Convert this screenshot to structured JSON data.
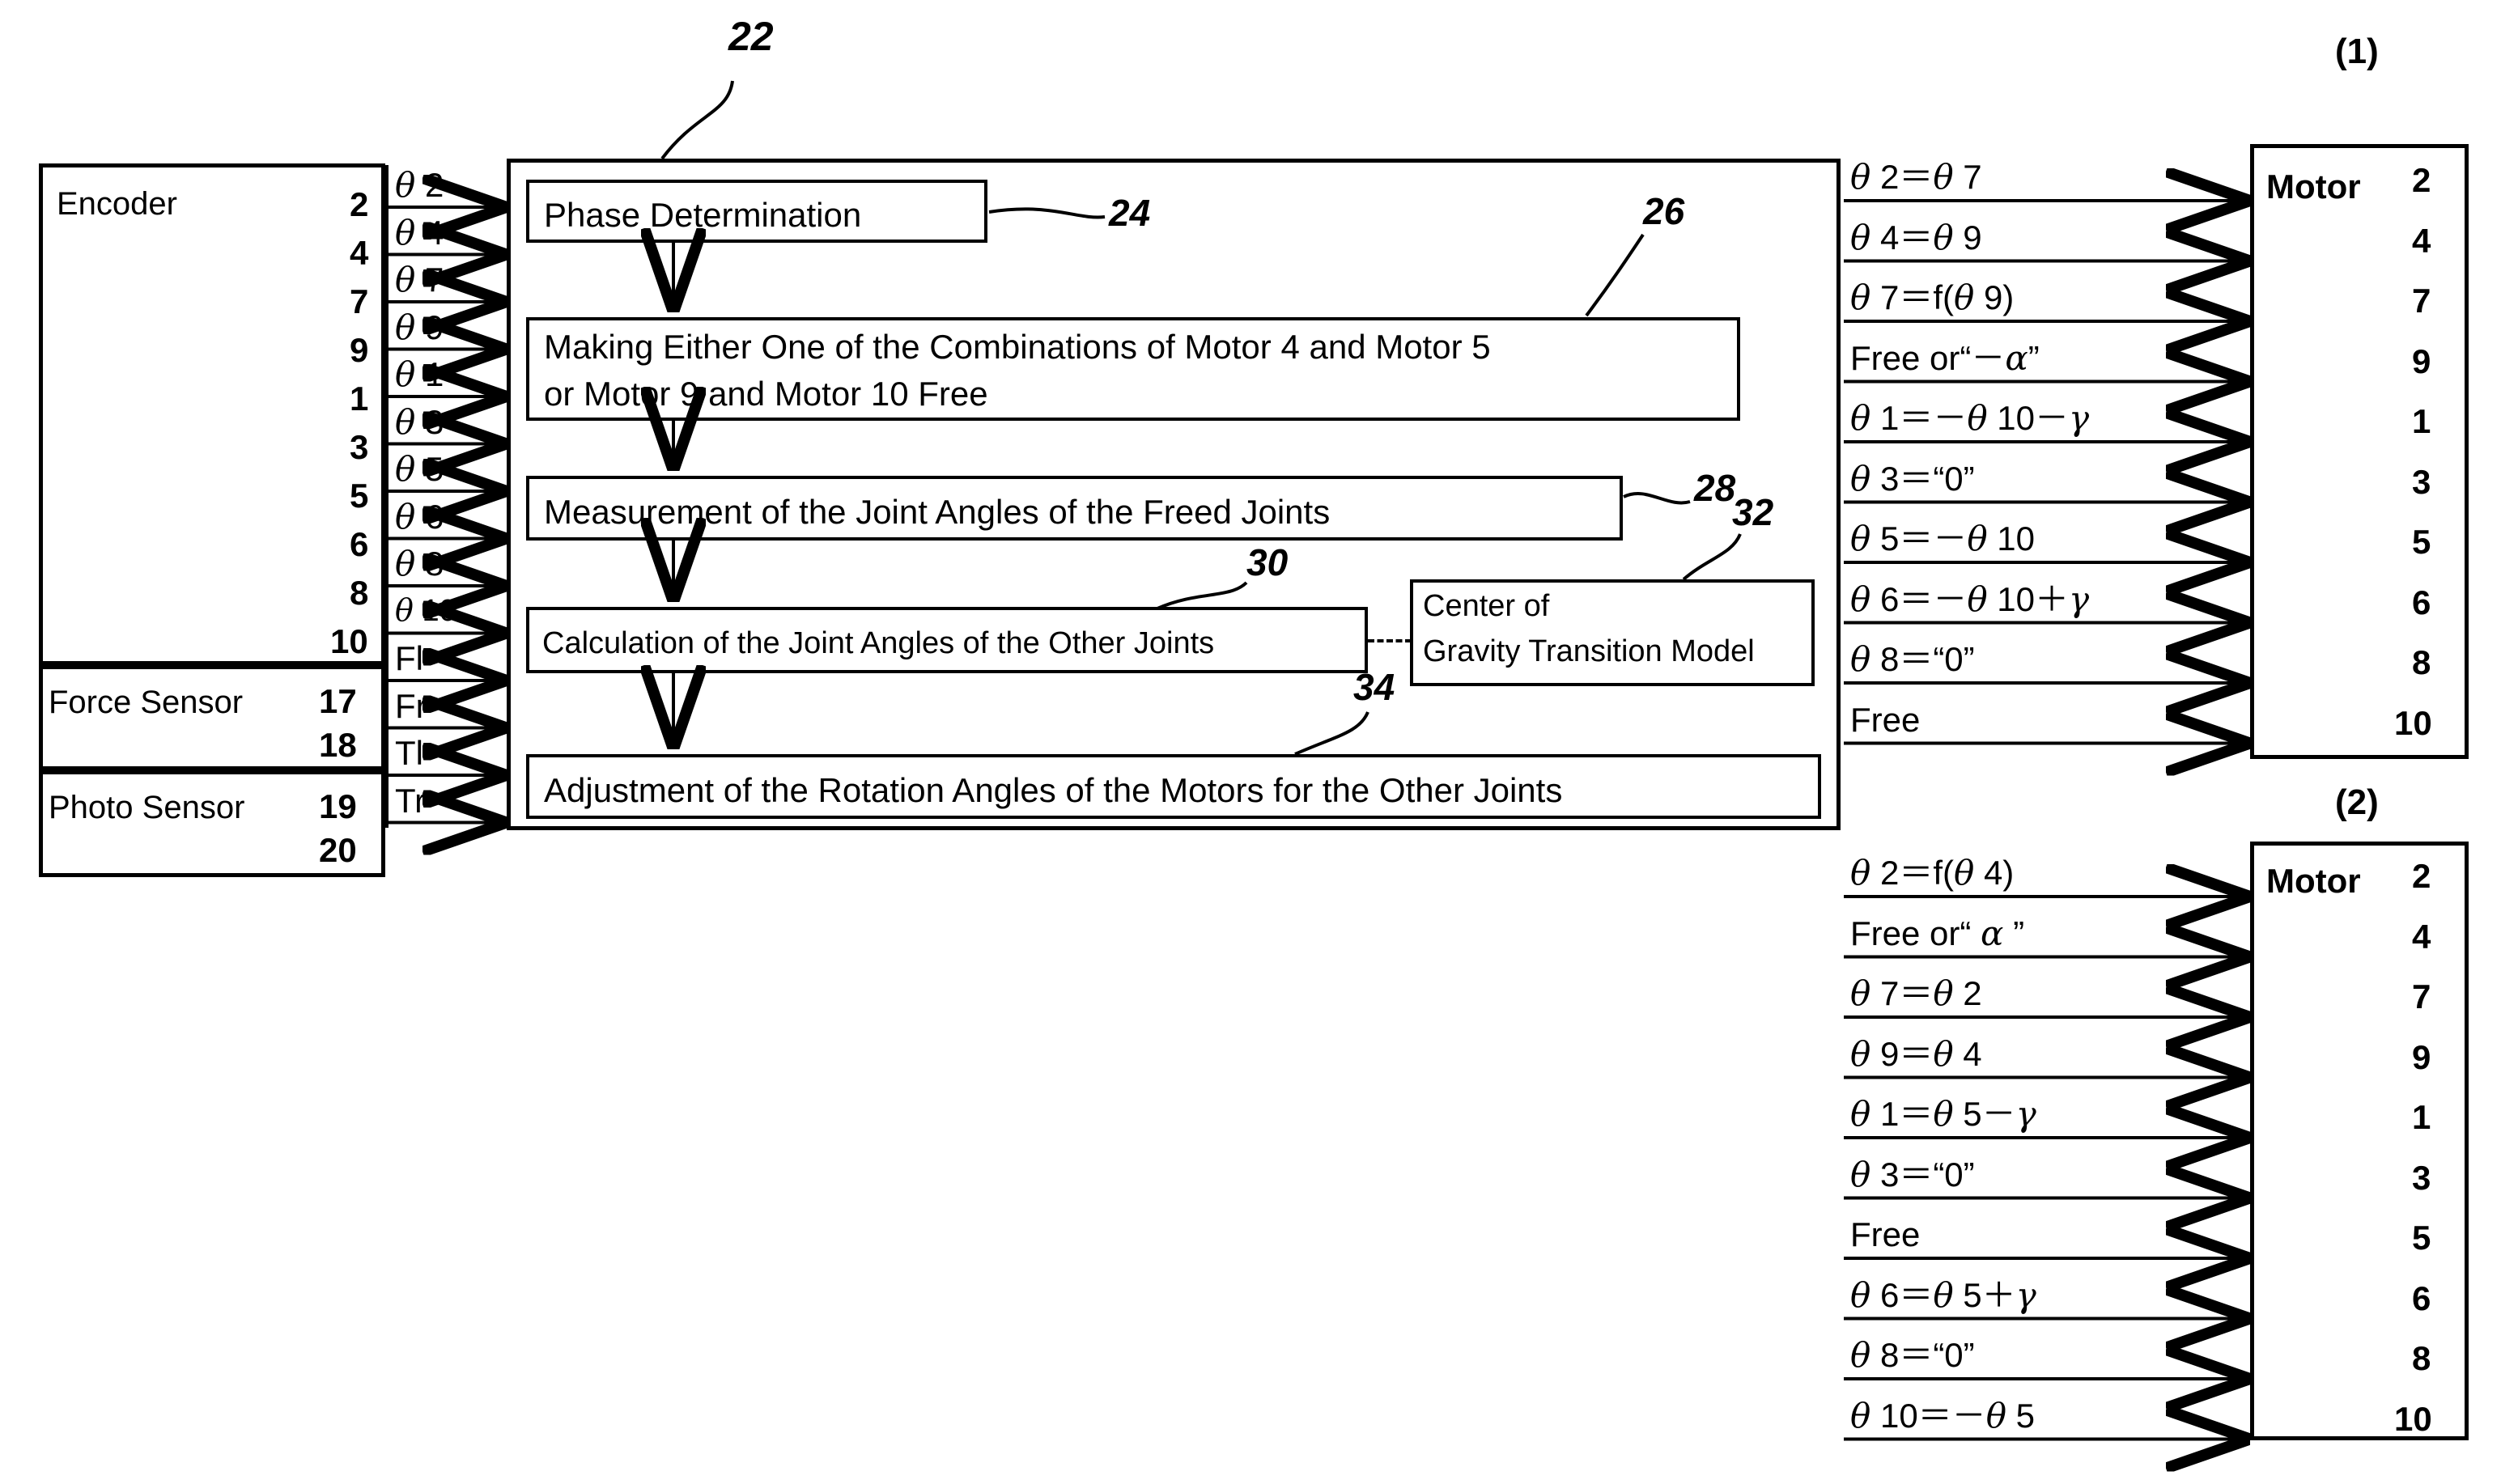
{
  "figure": {
    "main_block_ref": "22",
    "output_group_1_label": "(1)",
    "output_group_2_label": "(2)"
  },
  "sensors": {
    "encoder": {
      "name": "Encoder",
      "numbers": [
        "2",
        "4",
        "7",
        "9",
        "1",
        "3",
        "5",
        "6",
        "8",
        "10"
      ]
    },
    "force_sensor": {
      "name": "Force Sensor",
      "numbers": [
        "17",
        "18"
      ]
    },
    "photo_sensor": {
      "name": "Photo Sensor",
      "numbers": [
        "19",
        "20"
      ]
    }
  },
  "input_signals": [
    "θ 2",
    "θ 4",
    "θ 7",
    "θ 9",
    "θ 1",
    "θ 3",
    "θ 5",
    "θ 6",
    "θ 8",
    "θ 10",
    "Fl",
    "Fr",
    "Tl",
    "Tr"
  ],
  "process": {
    "steps": [
      {
        "ref": "24",
        "text": "Phase Determination"
      },
      {
        "ref": "26",
        "text": "Making Either One of the Combinations of Motor 4 and Motor 5 or Motor 9 and Motor 10 Free"
      },
      {
        "ref": "28",
        "text": "Measurement of the Joint Angles of the Freed Joints"
      },
      {
        "ref": "30",
        "text": "Calculation of the Joint Angles of the Other Joints"
      },
      {
        "ref": "34",
        "text": "Adjustment of the Rotation Angles of the Motors for the Other Joints"
      }
    ],
    "side_module": {
      "ref": "32",
      "line1": "Center of",
      "line2": "Gravity Transition Model"
    }
  },
  "outputs": {
    "group1": {
      "group_label": "(1)",
      "motor_word": "Motor",
      "motor_numbers": [
        "2",
        "4",
        "7",
        "9",
        "1",
        "3",
        "5",
        "6",
        "8",
        "10"
      ],
      "signals": [
        "θ 2＝θ 7",
        "θ 4＝θ 9",
        "θ 7＝f(θ 9)",
        "Free or“－α”",
        "θ 1＝－θ 10－γ",
        "θ 3＝“0”",
        "θ 5＝－θ 10",
        "θ 6＝－θ 10＋γ",
        "θ 8＝“0”",
        "Free"
      ]
    },
    "group2": {
      "group_label": "(2)",
      "motor_word": "Motor",
      "motor_numbers": [
        "2",
        "4",
        "7",
        "9",
        "1",
        "3",
        "5",
        "6",
        "8",
        "10"
      ],
      "signals": [
        "θ 2＝f(θ 4)",
        "Free or“ α ”",
        "θ 7＝θ 2",
        "θ 9＝θ 4",
        "θ 1＝θ 5－γ",
        "θ 3＝“0”",
        "Free",
        "θ 6＝θ 5＋γ",
        "θ 8＝“0”",
        "θ 10＝－θ 5"
      ]
    }
  }
}
